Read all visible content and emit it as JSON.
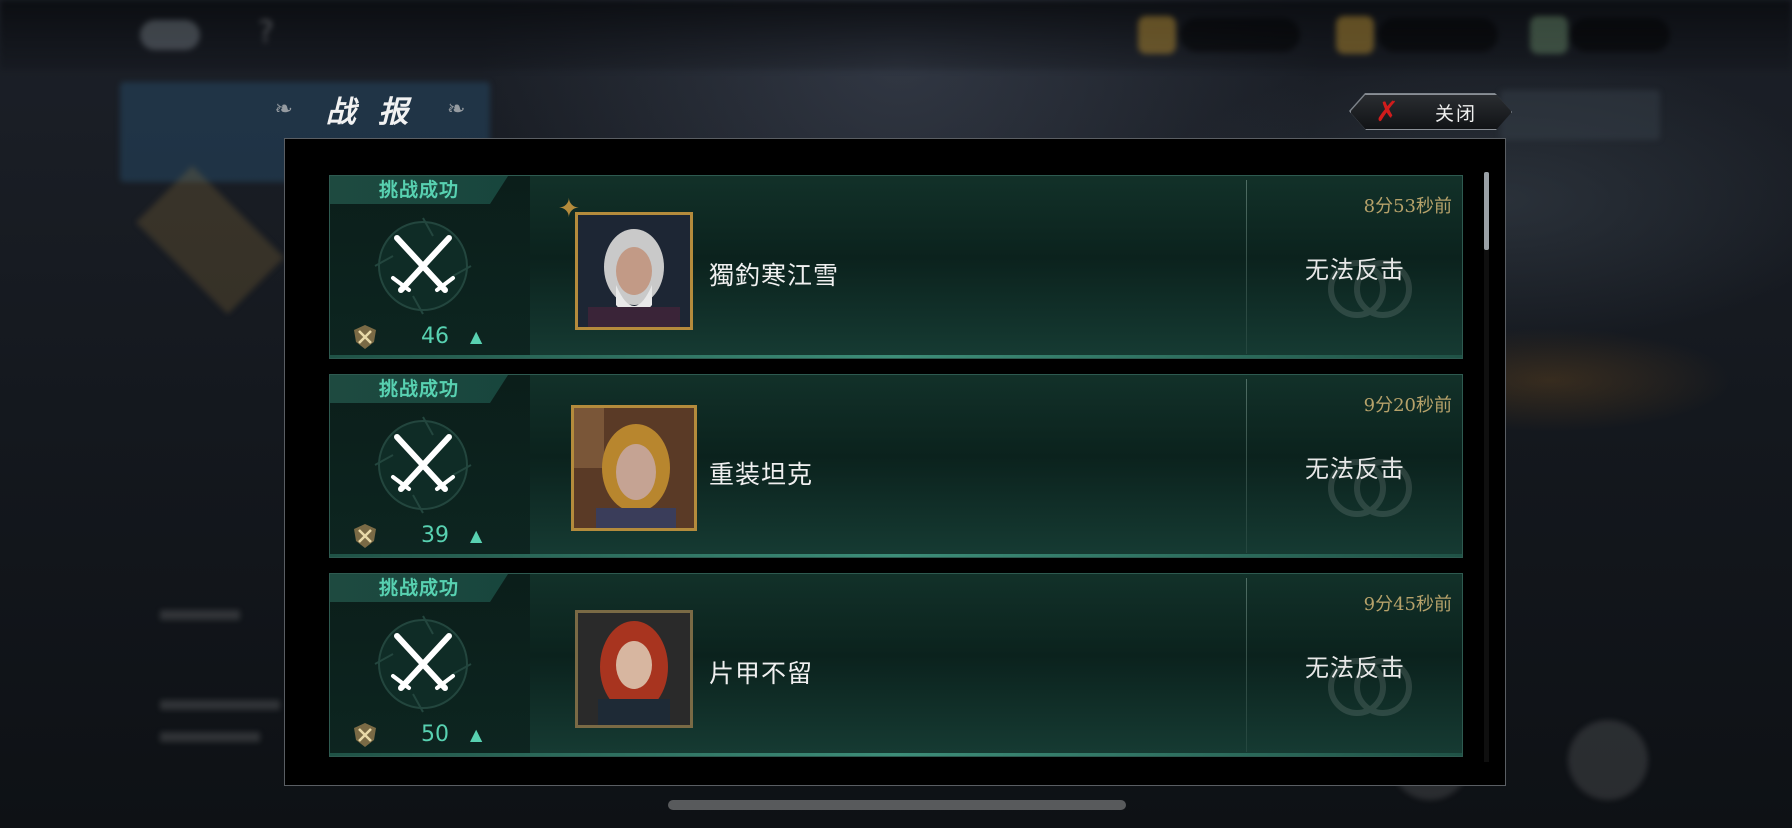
{
  "dialog": {
    "title": "战 报",
    "title_left_ornament": "ornament-icon",
    "title_right_ornament": "ornament-icon",
    "close_label": "关闭",
    "close_icon": "close-x-icon"
  },
  "colors": {
    "accent_teal": "#58d1b1",
    "time_gold": "#b6a26a",
    "close_x_red": "#d01c1c"
  },
  "reports": [
    {
      "status": "挑战成功",
      "rank": "46",
      "rank_change": "▲",
      "player_name": "獨釣寒江雪",
      "time_ago": "8分53秒前",
      "counter_status": "无法反击"
    },
    {
      "status": "挑战成功",
      "rank": "39",
      "rank_change": "▲",
      "player_name": "重装坦克",
      "time_ago": "9分20秒前",
      "counter_status": "无法反击"
    },
    {
      "status": "挑战成功",
      "rank": "50",
      "rank_change": "▲",
      "player_name": "片甲不留",
      "time_ago": "9分45秒前",
      "counter_status": "无法反击"
    }
  ]
}
